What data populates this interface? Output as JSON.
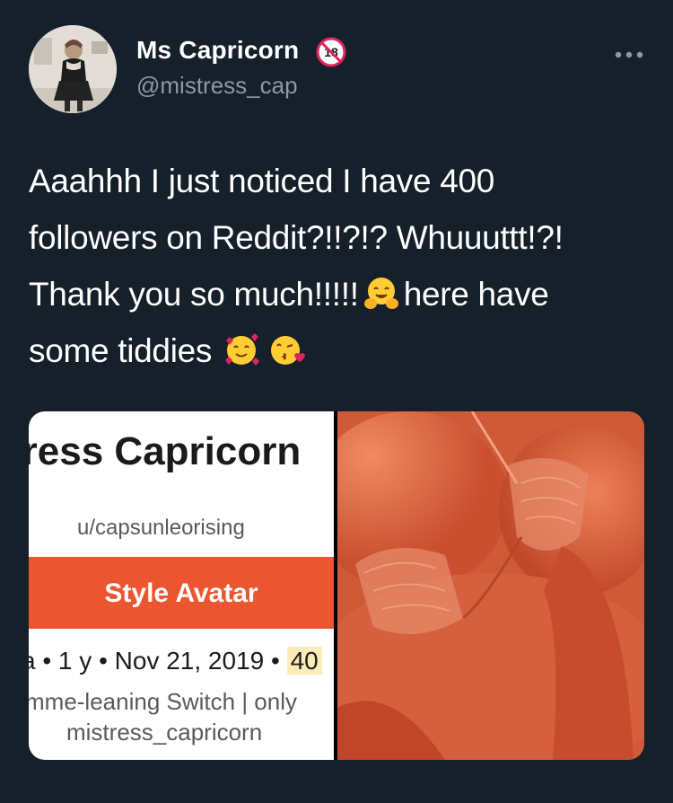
{
  "tweet": {
    "author": {
      "display_name": "Ms Capricorn",
      "handle": "@mistress_cap",
      "badge_icon": "18-plus-prohibited-icon",
      "avatar_icon": "profile-photo"
    },
    "more_icon": "more-options-icon",
    "text": {
      "line1": "Aaahhh I just noticed I have 400",
      "line2": "followers on Reddit?!!?!? Whuuuttt!?!",
      "line3_before_emoji": "Thank you so much!!!!!",
      "line3_after_emoji": "here have",
      "line4": "some tiddies"
    },
    "emojis": {
      "hug": "hugging-face-emoji",
      "hearts": "smiling-face-with-hearts-emoji",
      "kiss": "face-blowing-kiss-emoji"
    }
  },
  "media": {
    "left_image": {
      "profile_name": "tress Capricorn",
      "username": "u/capsunleorising",
      "button_label": "Style Avatar",
      "meta_prefix": "a • 1 y • Nov 21, 2019 •",
      "meta_karma": "40",
      "bio_line1": "mme-leaning Switch | only",
      "bio_line2": "mistress_capricorn"
    },
    "right_image": {
      "description_icon": "photo"
    }
  },
  "colors": {
    "background": "#15202b",
    "text_primary": "#ffffff",
    "text_secondary": "#8b98a5",
    "reddit_orange": "#eb5530",
    "photo_tone": "#d9633f"
  }
}
